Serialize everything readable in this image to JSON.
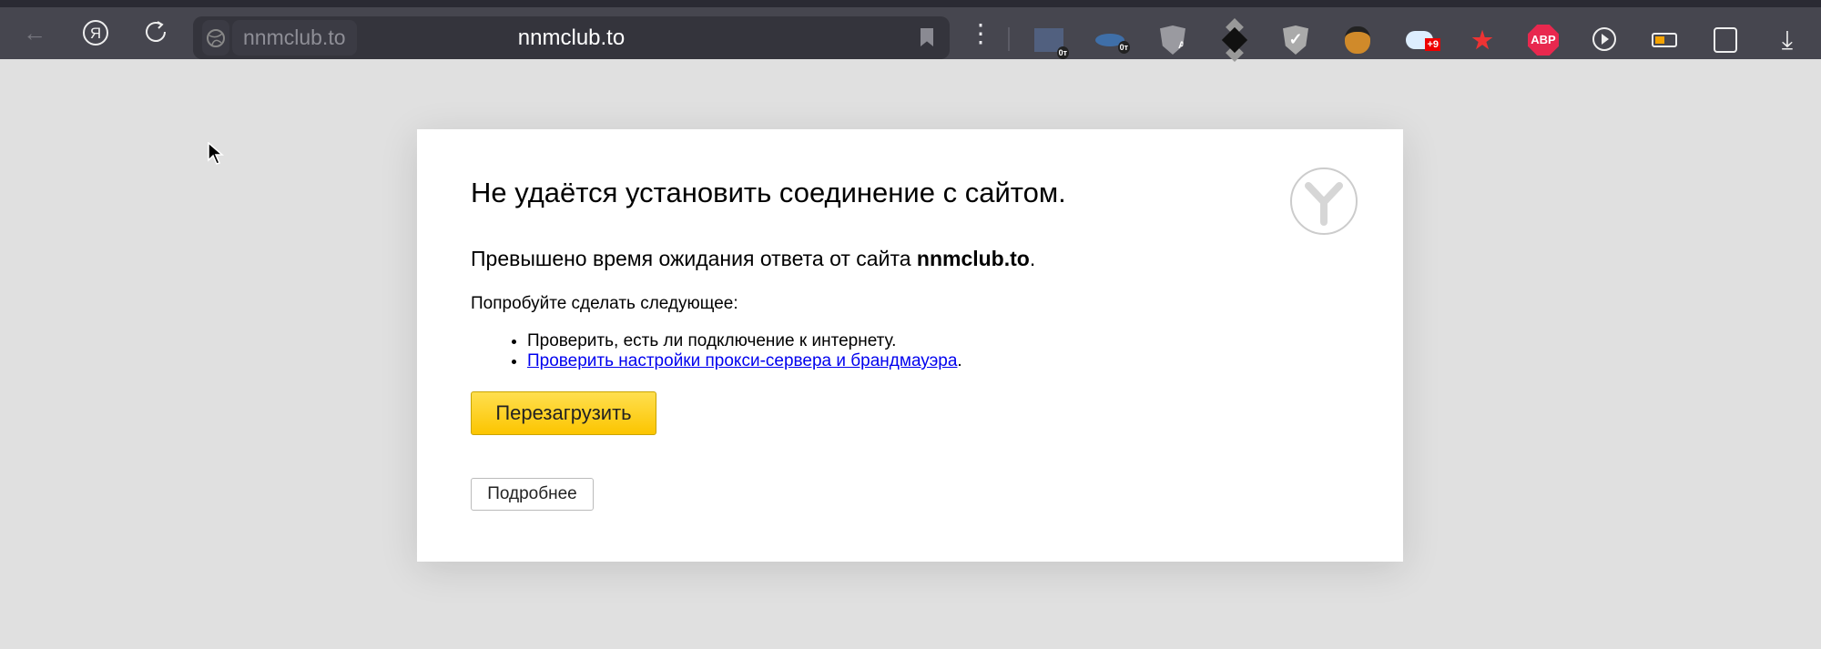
{
  "browser": {
    "address_chip": "nnmclub.to",
    "url": "nnmclub.to",
    "extensions": [
      {
        "name": "mail-extension-icon",
        "label": "0т"
      },
      {
        "name": "vpn-extension-icon",
        "label": "0т"
      },
      {
        "name": "adguard-a-icon",
        "label": "A"
      },
      {
        "name": "diamond-extension-icon",
        "label": ""
      },
      {
        "name": "shield-check-icon",
        "label": ""
      },
      {
        "name": "bear-extension-icon",
        "label": ""
      },
      {
        "name": "cloud-extension-icon",
        "label": "+9"
      },
      {
        "name": "stars-extension-icon",
        "label": ""
      },
      {
        "name": "adblock-plus-icon",
        "label": "ABP"
      },
      {
        "name": "media-play-icon",
        "label": ""
      },
      {
        "name": "battery-icon",
        "label": ""
      },
      {
        "name": "sidebar-extension-icon",
        "label": ""
      },
      {
        "name": "download-icon",
        "label": ""
      }
    ]
  },
  "error": {
    "title": "Не удаётся установить соединение с сайтом.",
    "message_prefix": "Превышено время ожидания ответа от сайта ",
    "message_host": "nnmclub.to",
    "message_suffix": ".",
    "try_label": "Попробуйте сделать следующее:",
    "suggestion_1": "Проверить, есть ли подключение к интернету.",
    "suggestion_2_link": "Проверить настройки прокси-сервера и брандмауэра",
    "suggestion_2_suffix": ".",
    "reload_button": "Перезагрузить",
    "details_button": "Подробнее"
  }
}
